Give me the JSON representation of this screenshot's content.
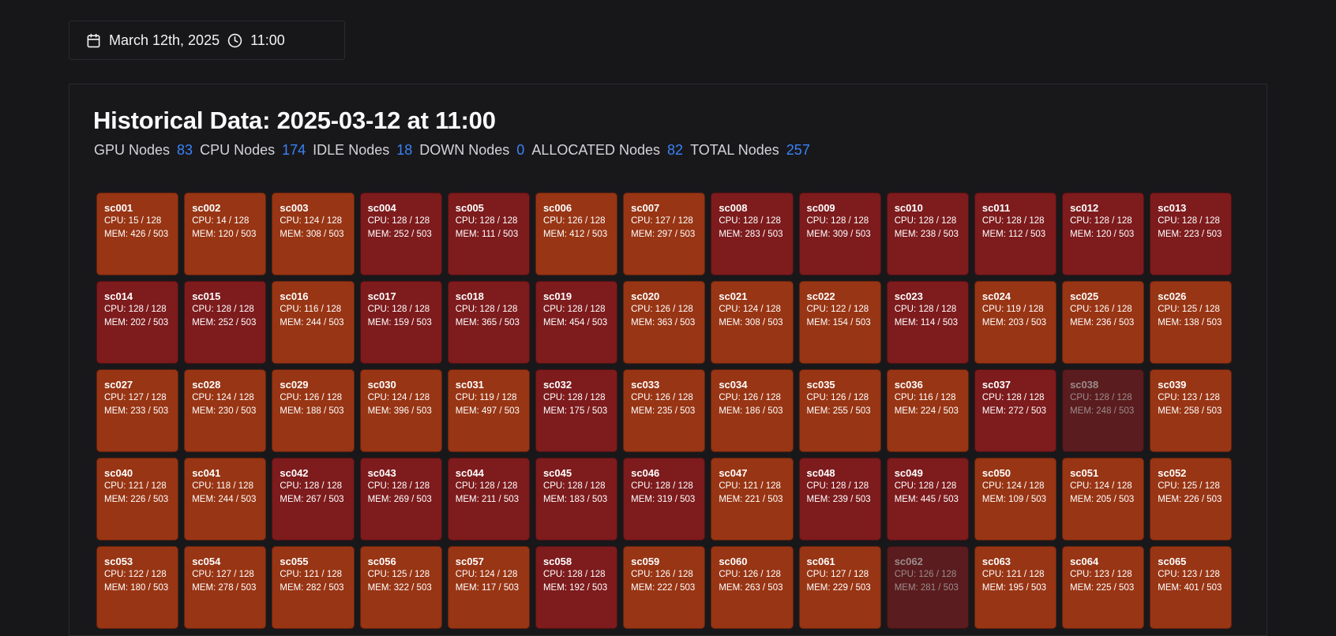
{
  "datebar": {
    "date": "March 12th, 2025",
    "time": "11:00"
  },
  "title": "Historical Data: 2025-03-12 at 11:00",
  "stats": [
    {
      "label": "GPU Nodes",
      "value": "83"
    },
    {
      "label": "CPU Nodes",
      "value": "174"
    },
    {
      "label": "IDLE Nodes",
      "value": "18"
    },
    {
      "label": "DOWN Nodes",
      "value": "0"
    },
    {
      "label": "ALLOCATED Nodes",
      "value": "82"
    },
    {
      "label": "TOTAL Nodes",
      "value": "257"
    }
  ],
  "colors": {
    "orange": "#983514",
    "red": "#7d1b1d",
    "dim": "#5a1c1e",
    "accent": "#3b82f6"
  },
  "nodes": [
    {
      "name": "sc001",
      "cpu": "CPU: 15 / 128",
      "mem": "MEM: 426 / 503",
      "status": "orange"
    },
    {
      "name": "sc002",
      "cpu": "CPU: 14 / 128",
      "mem": "MEM: 120 / 503",
      "status": "orange"
    },
    {
      "name": "sc003",
      "cpu": "CPU: 124 / 128",
      "mem": "MEM: 308 / 503",
      "status": "orange"
    },
    {
      "name": "sc004",
      "cpu": "CPU: 128 / 128",
      "mem": "MEM: 252 / 503",
      "status": "red"
    },
    {
      "name": "sc005",
      "cpu": "CPU: 128 / 128",
      "mem": "MEM: 111 / 503",
      "status": "red"
    },
    {
      "name": "sc006",
      "cpu": "CPU: 126 / 128",
      "mem": "MEM: 412 / 503",
      "status": "orange"
    },
    {
      "name": "sc007",
      "cpu": "CPU: 127 / 128",
      "mem": "MEM: 297 / 503",
      "status": "orange"
    },
    {
      "name": "sc008",
      "cpu": "CPU: 128 / 128",
      "mem": "MEM: 283 / 503",
      "status": "red"
    },
    {
      "name": "sc009",
      "cpu": "CPU: 128 / 128",
      "mem": "MEM: 309 / 503",
      "status": "red"
    },
    {
      "name": "sc010",
      "cpu": "CPU: 128 / 128",
      "mem": "MEM: 238 / 503",
      "status": "red"
    },
    {
      "name": "sc011",
      "cpu": "CPU: 128 / 128",
      "mem": "MEM: 112 / 503",
      "status": "red"
    },
    {
      "name": "sc012",
      "cpu": "CPU: 128 / 128",
      "mem": "MEM: 120 / 503",
      "status": "red"
    },
    {
      "name": "sc013",
      "cpu": "CPU: 128 / 128",
      "mem": "MEM: 223 / 503",
      "status": "red"
    },
    {
      "name": "sc014",
      "cpu": "CPU: 128 / 128",
      "mem": "MEM: 202 / 503",
      "status": "red"
    },
    {
      "name": "sc015",
      "cpu": "CPU: 128 / 128",
      "mem": "MEM: 252 / 503",
      "status": "red"
    },
    {
      "name": "sc016",
      "cpu": "CPU: 116 / 128",
      "mem": "MEM: 244 / 503",
      "status": "orange"
    },
    {
      "name": "sc017",
      "cpu": "CPU: 128 / 128",
      "mem": "MEM: 159 / 503",
      "status": "red"
    },
    {
      "name": "sc018",
      "cpu": "CPU: 128 / 128",
      "mem": "MEM: 365 / 503",
      "status": "red"
    },
    {
      "name": "sc019",
      "cpu": "CPU: 128 / 128",
      "mem": "MEM: 454 / 503",
      "status": "red"
    },
    {
      "name": "sc020",
      "cpu": "CPU: 126 / 128",
      "mem": "MEM: 363 / 503",
      "status": "orange"
    },
    {
      "name": "sc021",
      "cpu": "CPU: 124 / 128",
      "mem": "MEM: 308 / 503",
      "status": "orange"
    },
    {
      "name": "sc022",
      "cpu": "CPU: 122 / 128",
      "mem": "MEM: 154 / 503",
      "status": "orange"
    },
    {
      "name": "sc023",
      "cpu": "CPU: 128 / 128",
      "mem": "MEM: 114 / 503",
      "status": "red"
    },
    {
      "name": "sc024",
      "cpu": "CPU: 119 / 128",
      "mem": "MEM: 203 / 503",
      "status": "orange"
    },
    {
      "name": "sc025",
      "cpu": "CPU: 126 / 128",
      "mem": "MEM: 236 / 503",
      "status": "orange"
    },
    {
      "name": "sc026",
      "cpu": "CPU: 125 / 128",
      "mem": "MEM: 138 / 503",
      "status": "orange"
    },
    {
      "name": "sc027",
      "cpu": "CPU: 127 / 128",
      "mem": "MEM: 233 / 503",
      "status": "orange"
    },
    {
      "name": "sc028",
      "cpu": "CPU: 124 / 128",
      "mem": "MEM: 230 / 503",
      "status": "orange"
    },
    {
      "name": "sc029",
      "cpu": "CPU: 126 / 128",
      "mem": "MEM: 188 / 503",
      "status": "orange"
    },
    {
      "name": "sc030",
      "cpu": "CPU: 124 / 128",
      "mem": "MEM: 396 / 503",
      "status": "orange"
    },
    {
      "name": "sc031",
      "cpu": "CPU: 119 / 128",
      "mem": "MEM: 497 / 503",
      "status": "orange"
    },
    {
      "name": "sc032",
      "cpu": "CPU: 128 / 128",
      "mem": "MEM: 175 / 503",
      "status": "red"
    },
    {
      "name": "sc033",
      "cpu": "CPU: 126 / 128",
      "mem": "MEM: 235 / 503",
      "status": "orange"
    },
    {
      "name": "sc034",
      "cpu": "CPU: 126 / 128",
      "mem": "MEM: 186 / 503",
      "status": "orange"
    },
    {
      "name": "sc035",
      "cpu": "CPU: 126 / 128",
      "mem": "MEM: 255 / 503",
      "status": "orange"
    },
    {
      "name": "sc036",
      "cpu": "CPU: 116 / 128",
      "mem": "MEM: 224 / 503",
      "status": "orange"
    },
    {
      "name": "sc037",
      "cpu": "CPU: 128 / 128",
      "mem": "MEM: 272 / 503",
      "status": "red"
    },
    {
      "name": "sc038",
      "cpu": "CPU: 128 / 128",
      "mem": "MEM: 248 / 503",
      "status": "dim"
    },
    {
      "name": "sc039",
      "cpu": "CPU: 123 / 128",
      "mem": "MEM: 258 / 503",
      "status": "orange"
    },
    {
      "name": "sc040",
      "cpu": "CPU: 121 / 128",
      "mem": "MEM: 226 / 503",
      "status": "orange"
    },
    {
      "name": "sc041",
      "cpu": "CPU: 118 / 128",
      "mem": "MEM: 244 / 503",
      "status": "orange"
    },
    {
      "name": "sc042",
      "cpu": "CPU: 128 / 128",
      "mem": "MEM: 267 / 503",
      "status": "red"
    },
    {
      "name": "sc043",
      "cpu": "CPU: 128 / 128",
      "mem": "MEM: 269 / 503",
      "status": "red"
    },
    {
      "name": "sc044",
      "cpu": "CPU: 128 / 128",
      "mem": "MEM: 211 / 503",
      "status": "red"
    },
    {
      "name": "sc045",
      "cpu": "CPU: 128 / 128",
      "mem": "MEM: 183 / 503",
      "status": "red"
    },
    {
      "name": "sc046",
      "cpu": "CPU: 128 / 128",
      "mem": "MEM: 319 / 503",
      "status": "red"
    },
    {
      "name": "sc047",
      "cpu": "CPU: 121 / 128",
      "mem": "MEM: 221 / 503",
      "status": "orange"
    },
    {
      "name": "sc048",
      "cpu": "CPU: 128 / 128",
      "mem": "MEM: 239 / 503",
      "status": "red"
    },
    {
      "name": "sc049",
      "cpu": "CPU: 128 / 128",
      "mem": "MEM: 445 / 503",
      "status": "red"
    },
    {
      "name": "sc050",
      "cpu": "CPU: 124 / 128",
      "mem": "MEM: 109 / 503",
      "status": "orange"
    },
    {
      "name": "sc051",
      "cpu": "CPU: 124 / 128",
      "mem": "MEM: 205 / 503",
      "status": "orange"
    },
    {
      "name": "sc052",
      "cpu": "CPU: 125 / 128",
      "mem": "MEM: 226 / 503",
      "status": "orange"
    },
    {
      "name": "sc053",
      "cpu": "CPU: 122 / 128",
      "mem": "MEM: 180 / 503",
      "status": "orange"
    },
    {
      "name": "sc054",
      "cpu": "CPU: 127 / 128",
      "mem": "MEM: 278 / 503",
      "status": "orange"
    },
    {
      "name": "sc055",
      "cpu": "CPU: 121 / 128",
      "mem": "MEM: 282 / 503",
      "status": "orange"
    },
    {
      "name": "sc056",
      "cpu": "CPU: 125 / 128",
      "mem": "MEM: 322 / 503",
      "status": "orange"
    },
    {
      "name": "sc057",
      "cpu": "CPU: 124 / 128",
      "mem": "MEM: 117 / 503",
      "status": "orange"
    },
    {
      "name": "sc058",
      "cpu": "CPU: 128 / 128",
      "mem": "MEM: 192 / 503",
      "status": "red"
    },
    {
      "name": "sc059",
      "cpu": "CPU: 126 / 128",
      "mem": "MEM: 222 / 503",
      "status": "orange"
    },
    {
      "name": "sc060",
      "cpu": "CPU: 126 / 128",
      "mem": "MEM: 263 / 503",
      "status": "orange"
    },
    {
      "name": "sc061",
      "cpu": "CPU: 127 / 128",
      "mem": "MEM: 229 / 503",
      "status": "orange"
    },
    {
      "name": "sc062",
      "cpu": "CPU: 126 / 128",
      "mem": "MEM: 281 / 503",
      "status": "dim"
    },
    {
      "name": "sc063",
      "cpu": "CPU: 121 / 128",
      "mem": "MEM: 195 / 503",
      "status": "orange"
    },
    {
      "name": "sc064",
      "cpu": "CPU: 123 / 128",
      "mem": "MEM: 225 / 503",
      "status": "orange"
    },
    {
      "name": "sc065",
      "cpu": "CPU: 123 / 128",
      "mem": "MEM: 401 / 503",
      "status": "orange"
    }
  ]
}
